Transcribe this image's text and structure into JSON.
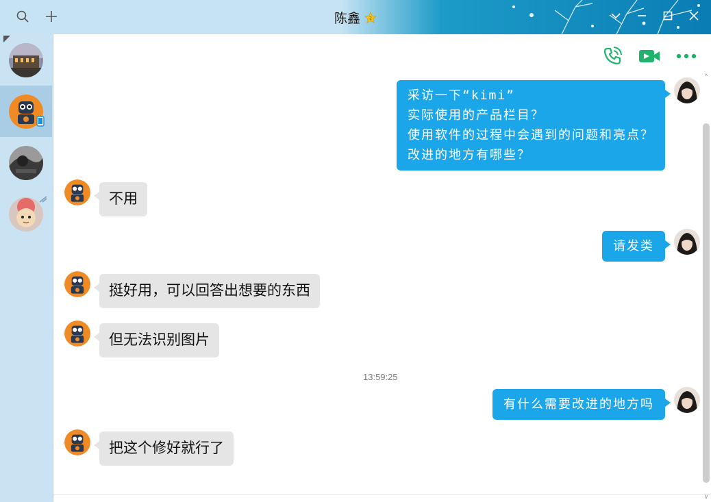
{
  "window": {
    "title": "陈鑫"
  },
  "titlebar_icons": [
    "search-icon",
    "plus-icon",
    "chevron-down-icon",
    "minimize-icon",
    "maximize-icon",
    "close-icon"
  ],
  "toolbar_icons": [
    "voice-call-icon",
    "video-call-icon",
    "more-icon"
  ],
  "colors": {
    "accent": "#1aa6e8",
    "incoming_bubble": "#e5e5e5",
    "sidebar": "#c9e3f3",
    "action_icon": "#20b36b"
  },
  "messages": [
    {
      "direction": "out",
      "lines": [
        "采访一下“kimi”",
        "实际使用的产品栏目？",
        "使用软件的过程中会遇到的问题和亮点？",
        "改进的地方有哪些？"
      ]
    },
    {
      "direction": "in",
      "text": "不用"
    },
    {
      "direction": "out",
      "lines": [
        "请发类"
      ]
    },
    {
      "direction": "in",
      "text": "挺好用，可以回答出想要的东西"
    },
    {
      "direction": "in",
      "text": "但无法识别图片"
    },
    {
      "direction": "time",
      "text": "13:59:25"
    },
    {
      "direction": "out",
      "lines": [
        "有什么需要改进的地方吗"
      ]
    },
    {
      "direction": "in",
      "text": "把这个修好就行了"
    }
  ]
}
